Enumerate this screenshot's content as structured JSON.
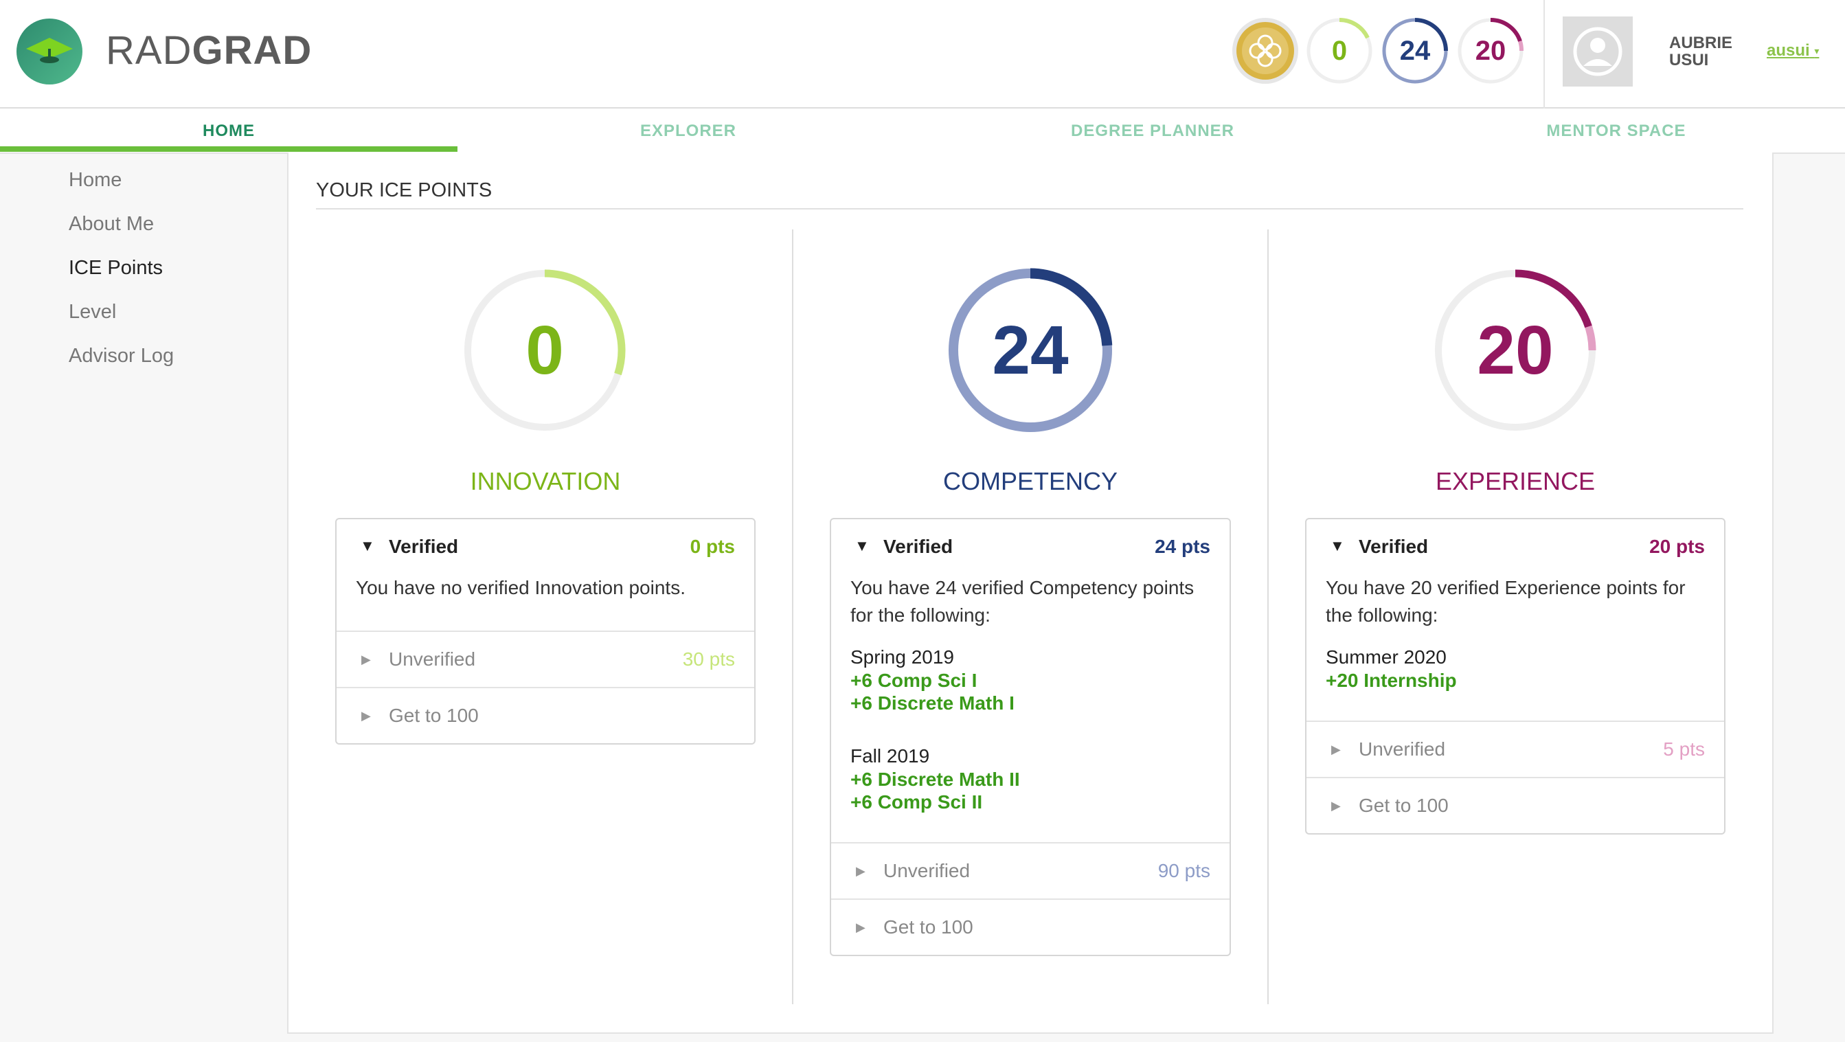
{
  "header": {
    "brand_part1": "RAD",
    "brand_part2": "GRAD",
    "badges": {
      "innovation": "0",
      "competency": "24",
      "experience": "20"
    },
    "user_first": "AUBRIE",
    "user_last": "USUI",
    "username": "ausui"
  },
  "nav": {
    "tabs": [
      {
        "label": "HOME"
      },
      {
        "label": "EXPLORER"
      },
      {
        "label": "DEGREE PLANNER"
      },
      {
        "label": "MENTOR SPACE"
      }
    ]
  },
  "sidebar": {
    "items": [
      {
        "label": "Home"
      },
      {
        "label": "About Me"
      },
      {
        "label": "ICE Points"
      },
      {
        "label": "Level"
      },
      {
        "label": "Advisor Log"
      }
    ]
  },
  "main": {
    "title": "YOUR ICE POINTS",
    "innovation": {
      "value": "0",
      "earned_fraction": 0,
      "planned_fraction": 0.3,
      "label": "INNOVATION",
      "verified_label": "Verified",
      "verified_pts": "0 pts",
      "verified_text": "You have no verified Innovation points.",
      "unverified_label": "Unverified",
      "unverified_pts": "30 pts",
      "get100_label": "Get to 100"
    },
    "competency": {
      "value": "24",
      "earned_fraction": 0.24,
      "planned_fraction": 1.0,
      "label": "COMPETENCY",
      "verified_label": "Verified",
      "verified_pts": "24 pts",
      "verified_text": "You have 24 verified Competency points for the following:",
      "terms": [
        {
          "term": "Spring 2019",
          "courses": [
            "+6 Comp Sci I",
            "+6 Discrete Math I"
          ]
        },
        {
          "term": "Fall 2019",
          "courses": [
            "+6 Discrete Math II",
            "+6 Comp Sci II"
          ]
        }
      ],
      "unverified_label": "Unverified",
      "unverified_pts": "90 pts",
      "get100_label": "Get to 100"
    },
    "experience": {
      "value": "20",
      "earned_fraction": 0.2,
      "planned_fraction": 0.25,
      "label": "EXPERIENCE",
      "verified_label": "Verified",
      "verified_pts": "20 pts",
      "verified_text": "You have 20 verified Experience points for the following:",
      "terms": [
        {
          "term": "Summer 2020",
          "courses": [
            "+20 Internship"
          ]
        }
      ],
      "unverified_label": "Unverified",
      "unverified_pts": "5 pts",
      "get100_label": "Get to 100"
    }
  },
  "colors": {
    "innovation": "#7cb518",
    "innovation_light": "#c6e57a",
    "competency": "#233e7c",
    "competency_light": "#8d9cc7",
    "experience": "#93175f",
    "experience_light": "#e3a0c4",
    "accent_green": "#6abf3b"
  }
}
